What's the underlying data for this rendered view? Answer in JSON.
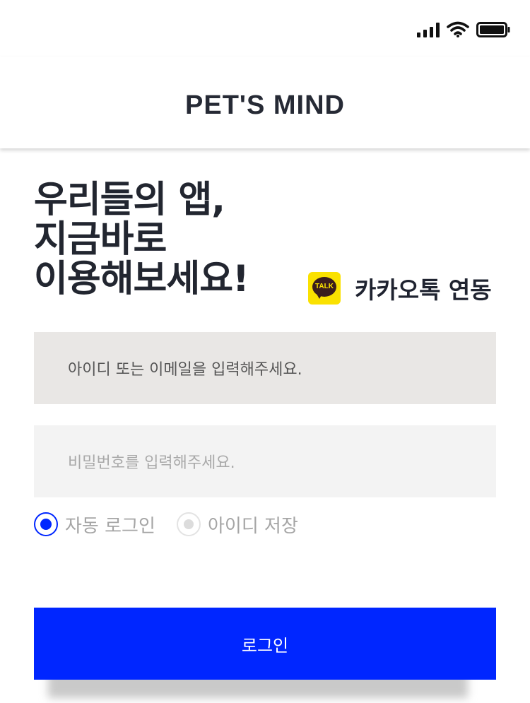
{
  "status_bar": {
    "signal_icon": "cellular-signal-icon",
    "wifi_icon": "wifi-icon",
    "battery_icon": "battery-full-icon"
  },
  "header": {
    "title": "PET'S MIND"
  },
  "headline": {
    "line1": "우리들의 앱,",
    "line2": "지금바로",
    "line3": "이용해보세요!"
  },
  "kakao": {
    "icon_text": "TALK",
    "label": "카카오톡 연동",
    "brand_color": "#fae100"
  },
  "form": {
    "id_placeholder": "아이디 또는 이메일을 입력해주세요.",
    "password_placeholder": "비밀번호를 입력해주세요."
  },
  "options": {
    "auto_login": {
      "label": "자동 로그인",
      "checked": true
    },
    "save_id": {
      "label": "아이디 저장",
      "checked": false
    }
  },
  "login_button": {
    "label": "로그인",
    "color": "#0026ff"
  }
}
